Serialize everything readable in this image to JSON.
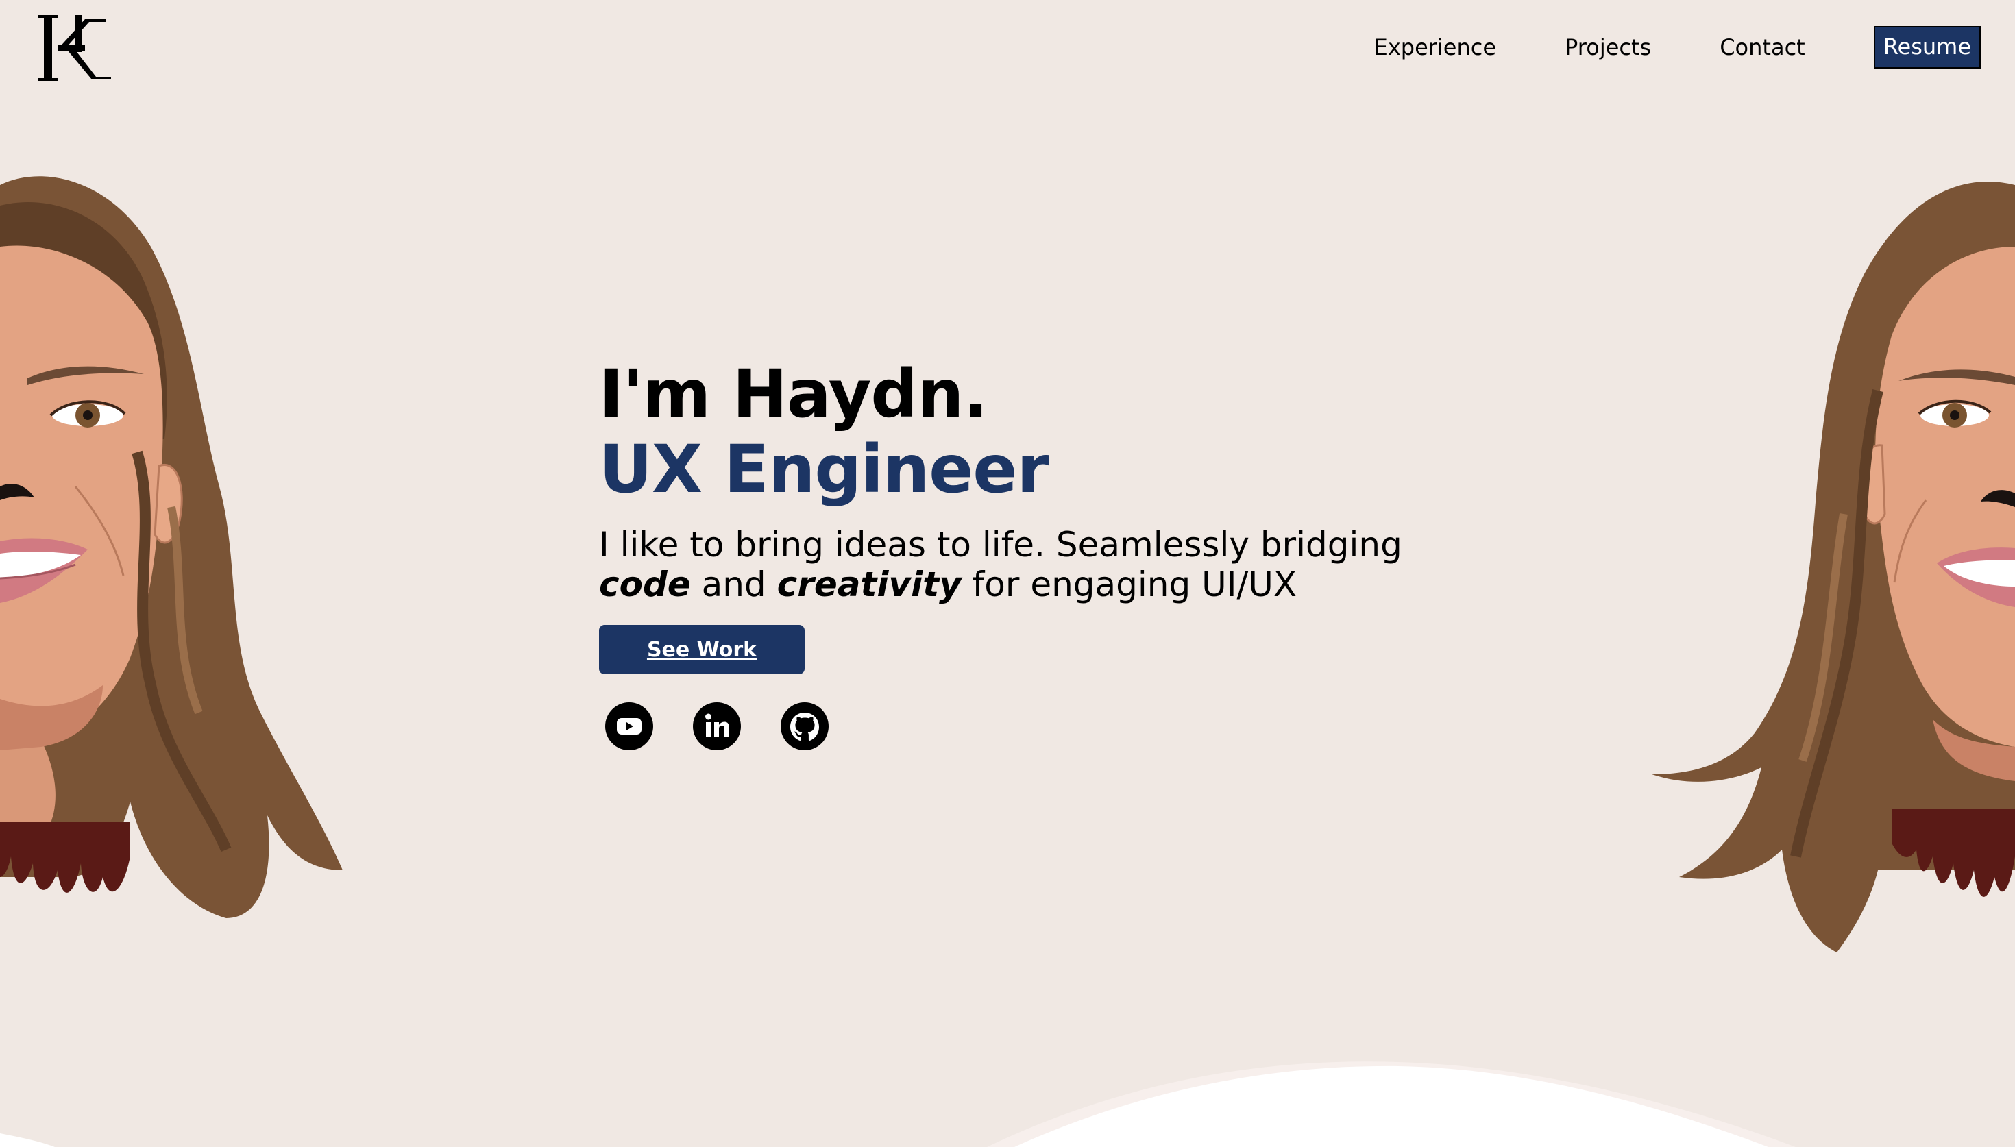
{
  "brand": {
    "logo_icon": "kh-monogram-logo"
  },
  "nav": {
    "items": [
      {
        "label": "Experience"
      },
      {
        "label": "Projects"
      },
      {
        "label": "Contact"
      }
    ],
    "resume_label": "Resume"
  },
  "hero": {
    "greeting": "I'm Haydn.",
    "role": "UX Engineer",
    "tagline_start": "I like to bring ideas to life. Seamlessly bridging",
    "tagline_code": "code",
    "tagline_and": " and ",
    "tagline_creativity": "creativity",
    "tagline_end": " for engaging UI/UX",
    "cta_label": "See Work"
  },
  "socials": [
    {
      "icon": "youtube-icon"
    },
    {
      "icon": "linkedin-icon"
    },
    {
      "icon": "github-icon"
    }
  ],
  "colors": {
    "background": "#f0e8e3",
    "accent": "#1c3564",
    "text": "#000000"
  }
}
